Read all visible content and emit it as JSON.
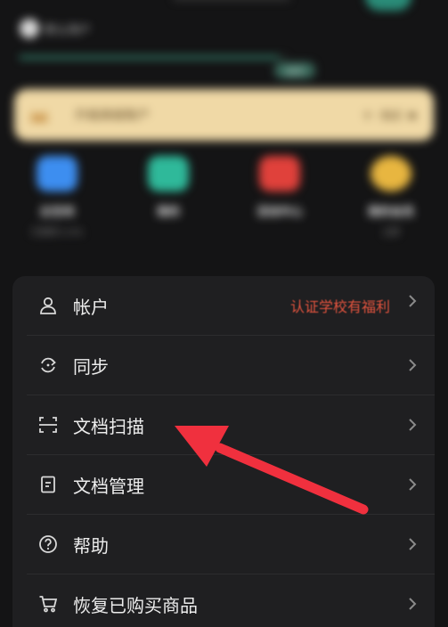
{
  "header": {
    "profile_name": "默认用户",
    "progress_fraction": 0.97,
    "progress_badge": "会员"
  },
  "promo": {
    "text": "升级高级账户",
    "price": "¥ · 购买",
    "arrow": "▶"
  },
  "quick_actions": [
    {
      "label": "云空间",
      "sub": "已使用 0.0%",
      "color": "#3d8ef0"
    },
    {
      "label": "我的",
      "sub": "",
      "color": "#2fb99a"
    },
    {
      "label": "活动中心",
      "sub": "",
      "color": "#e0413b"
    },
    {
      "label": "我的会员",
      "sub": "立即",
      "color": "#e8b640"
    }
  ],
  "settings": {
    "items": [
      {
        "label": "帐户",
        "icon": "person-icon",
        "badge": "认证学校有福利"
      },
      {
        "label": "同步",
        "icon": "sync-icon",
        "badge": ""
      },
      {
        "label": "文档扫描",
        "icon": "scan-icon",
        "badge": ""
      },
      {
        "label": "文档管理",
        "icon": "document-icon",
        "badge": ""
      },
      {
        "label": "帮助",
        "icon": "help-icon",
        "badge": ""
      },
      {
        "label": "恢复已购买商品",
        "icon": "cart-icon",
        "badge": ""
      }
    ]
  },
  "colors": {
    "background": "#141415",
    "card": "#1f1f21",
    "promo": "#f0d9a6",
    "badge_red": "#e0533e",
    "annotation_arrow": "#f0303e"
  }
}
